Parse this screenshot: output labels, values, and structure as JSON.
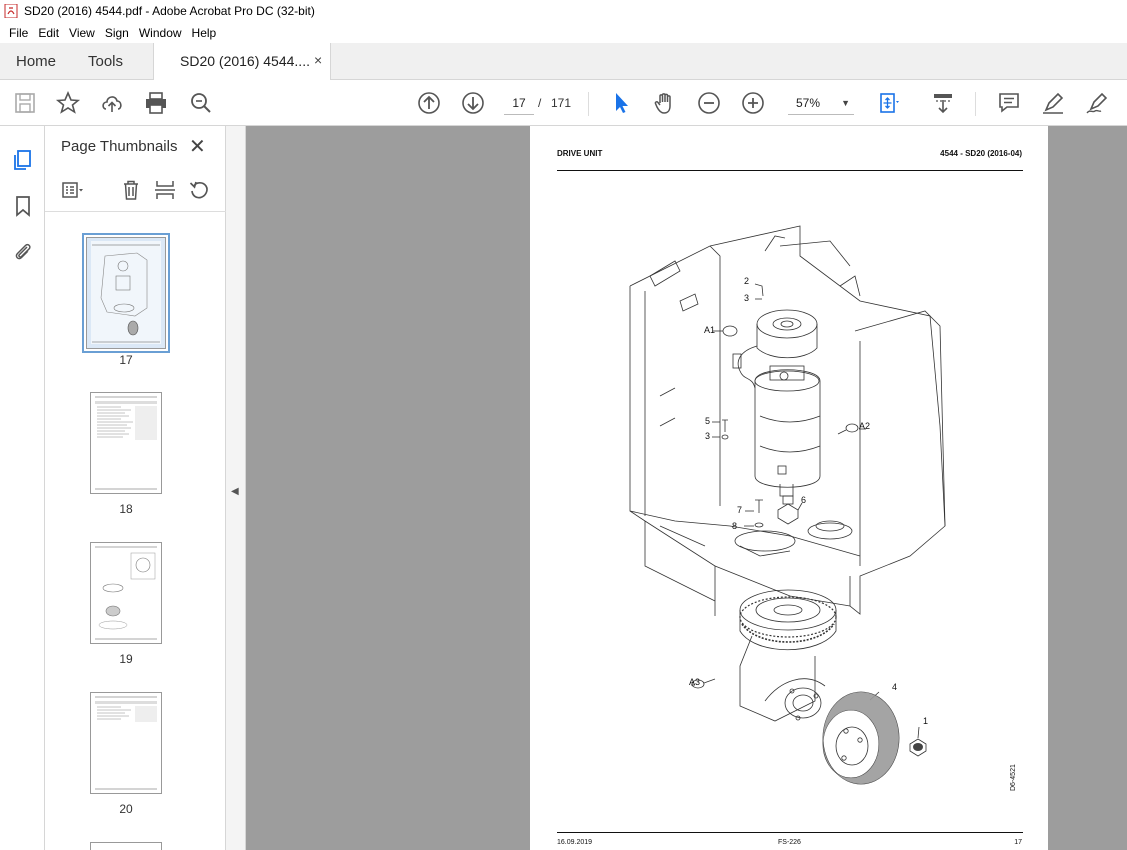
{
  "window": {
    "title": "SD20 (2016) 4544.pdf - Adobe Acrobat Pro DC (32-bit)"
  },
  "menu": [
    "File",
    "Edit",
    "View",
    "Sign",
    "Window",
    "Help"
  ],
  "tabs": {
    "home": "Home",
    "tools": "Tools",
    "document": "SD20 (2016) 4544....",
    "close": "×"
  },
  "toolbar": {
    "page_current": "17",
    "page_separator": "/",
    "page_total": "171",
    "zoom": "57%"
  },
  "thumbnails_panel": {
    "title": "Page Thumbnails",
    "close": "✕",
    "pages": [
      {
        "label": "17",
        "selected": true
      },
      {
        "label": "18",
        "selected": false
      },
      {
        "label": "19",
        "selected": false
      },
      {
        "label": "20",
        "selected": false
      }
    ]
  },
  "pdf_page": {
    "header_left": "DRIVE UNIT",
    "header_right": "4544 - SD20 (2016-04)",
    "footer_left": "16.09.2019",
    "footer_center": "FS-226",
    "footer_right": "17",
    "figure_ref": "D6-4521",
    "callouts": {
      "c2": "2",
      "c3a": "3",
      "a1": "A1",
      "c5": "5",
      "c3b": "3",
      "a2": "A2",
      "c6": "6",
      "c7": "7",
      "c8": "8",
      "a3": "A3",
      "c4": "4",
      "c1": "1"
    }
  },
  "colors": {
    "viewer_bg": "#9d9d9d",
    "accent": "#1a73e8",
    "selection": "#6a9fd4"
  }
}
